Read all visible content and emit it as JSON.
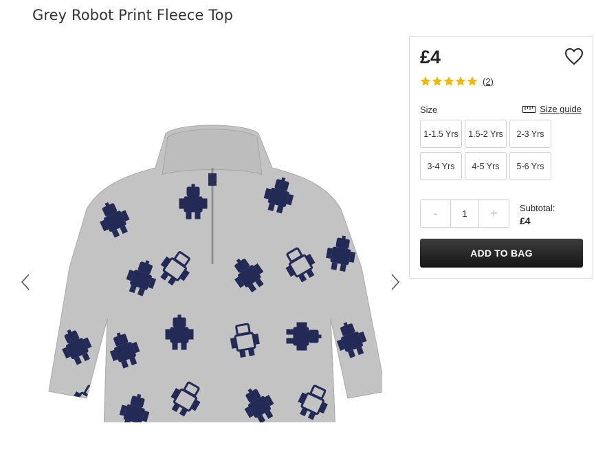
{
  "product": {
    "title": "Grey Robot Print Fleece Top",
    "image_alt": "Grey fleece top with navy robot print"
  },
  "gallery": {
    "prev_icon": "chevron-left-icon",
    "next_icon": "chevron-right-icon"
  },
  "buy_box": {
    "price": "£4",
    "rating_value": 5,
    "rating_max": 5,
    "review_count": "(2)",
    "size_label": "Size",
    "size_guide_label": "Size guide",
    "sizes": [
      "1-1.5 Yrs",
      "1.5-2 Yrs",
      "2-3 Yrs",
      "3-4 Yrs",
      "4-5 Yrs",
      "5-6 Yrs"
    ],
    "quantity": {
      "minus": "-",
      "value": "1",
      "plus": "+"
    },
    "subtotal_label": "Subtotal:",
    "subtotal_value": "£4",
    "add_to_bag_label": "ADD TO BAG"
  },
  "colors": {
    "star": "#f5b50a",
    "fleece": "#c3c3c3",
    "print": "#222a55",
    "button": "#222222"
  }
}
